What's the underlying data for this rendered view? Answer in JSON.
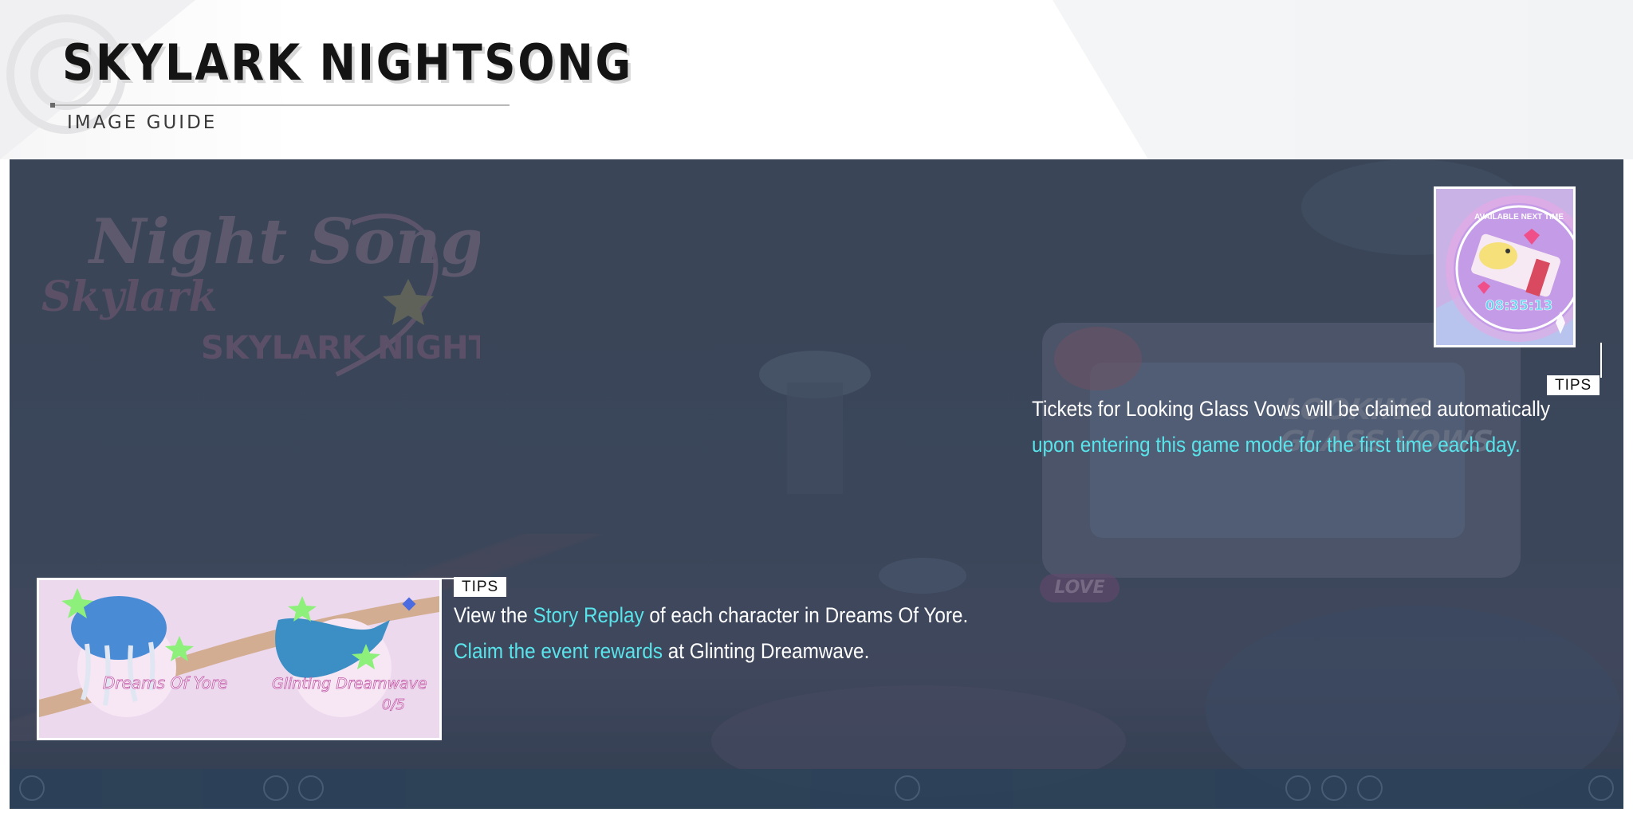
{
  "header": {
    "title": "SKYLARK NIGHTSONG",
    "subtitle": "IMAGE GUIDE"
  },
  "background": {
    "logo_line_1": "Night Song",
    "logo_line_2": "Skylark",
    "logo_line_3": "SKYLARK NIGHTSONG",
    "tv_label": "LOOKING GLASS VOWS",
    "love_tag": "LOVE"
  },
  "tip_right": {
    "badge": "TIPS",
    "line1": "Tickets for Looking Glass Vows will be claimed automatically",
    "line2": "upon entering this game mode for the first time each day.",
    "thumbnail": {
      "caption": "AVAILABLE NEXT TIME",
      "timer": "08:35:13"
    }
  },
  "tip_left": {
    "badge": "TIPS",
    "line1_a": "View the ",
    "line1_hl": "Story Replay",
    "line1_b": " of each character in Dreams Of Yore.",
    "line2_hl": "Claim the event rewards",
    "line2_b": " at Glinting Dreamwave.",
    "thumbnail": {
      "mode1": "Dreams Of Yore",
      "mode2": "Glinting Dreamwave",
      "mode2_progress": "0/5"
    }
  },
  "colors": {
    "highlight": "#58e4ea",
    "overlay": "#4a566a"
  }
}
